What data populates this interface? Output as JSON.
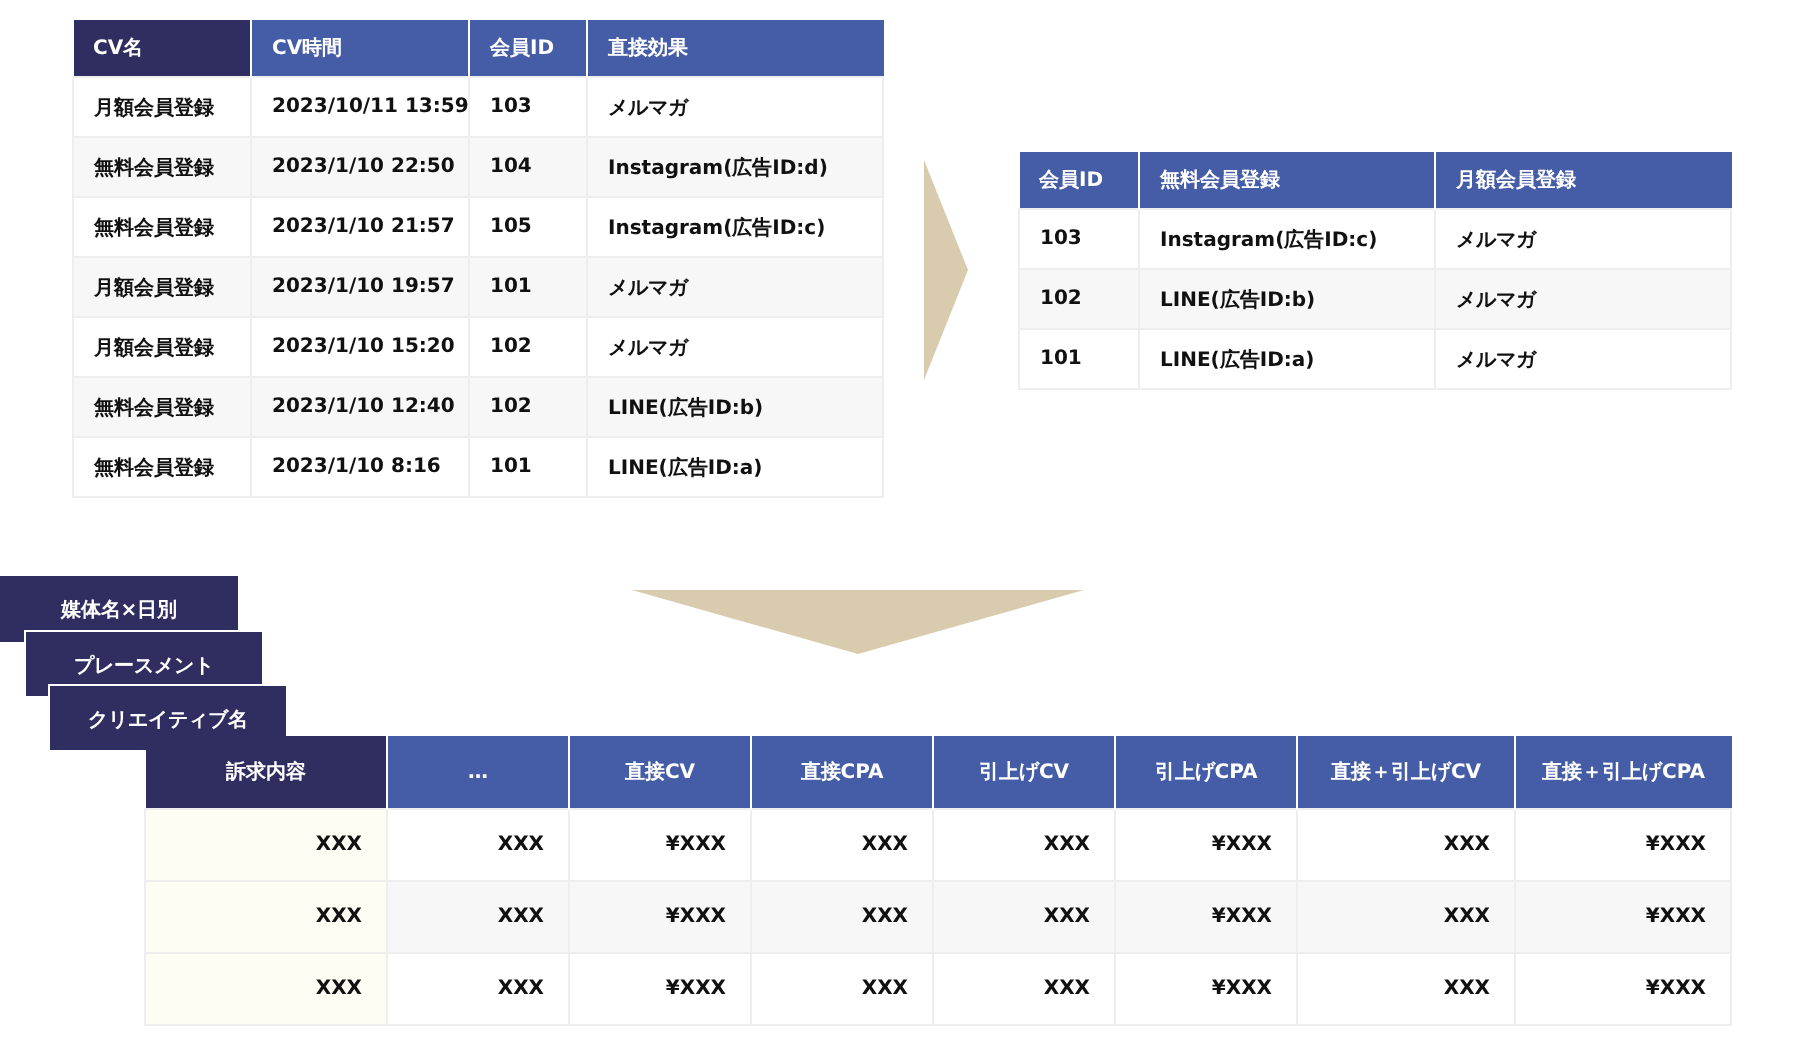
{
  "cv_table": {
    "columns": [
      {
        "label": "CV名",
        "emphasized": true
      },
      {
        "label": "CV時間",
        "emphasized": false
      },
      {
        "label": "会員ID",
        "emphasized": false
      },
      {
        "label": "直接効果",
        "emphasized": false
      }
    ],
    "rows": [
      [
        "月額会員登録",
        "2023/10/11 13:59",
        "103",
        "メルマガ"
      ],
      [
        "無料会員登録",
        "2023/1/10 22:50",
        "104",
        "Instagram(広告ID:d)"
      ],
      [
        "無料会員登録",
        "2023/1/10 21:57",
        "105",
        "Instagram(広告ID:c)"
      ],
      [
        "月額会員登録",
        "2023/1/10 19:57",
        "101",
        "メルマガ"
      ],
      [
        "月額会員登録",
        "2023/1/10 15:20",
        "102",
        "メルマガ"
      ],
      [
        "無料会員登録",
        "2023/1/10 12:40",
        "102",
        "LINE(広告ID:b)"
      ],
      [
        "無料会員登録",
        "2023/1/10 8:16",
        "101",
        "LINE(広告ID:a)"
      ]
    ]
  },
  "member_table": {
    "columns": [
      {
        "label": "会員ID",
        "emphasized": false
      },
      {
        "label": "無料会員登録",
        "emphasized": false
      },
      {
        "label": "月額会員登録",
        "emphasized": false
      }
    ],
    "rows": [
      [
        "103",
        "Instagram(広告ID:c)",
        "メルマガ"
      ],
      [
        "102",
        "LINE(広告ID:b)",
        "メルマガ"
      ],
      [
        "101",
        "LINE(広告ID:a)",
        "メルマガ"
      ]
    ]
  },
  "sheet_tabs": [
    "媒体名×日別",
    "プレースメント",
    "クリエイティブ名"
  ],
  "report_table": {
    "columns": [
      {
        "label": "訴求内容",
        "emphasized": true
      },
      {
        "label": "…",
        "emphasized": false
      },
      {
        "label": "直接CV",
        "emphasized": false
      },
      {
        "label": "直接CPA",
        "emphasized": false
      },
      {
        "label": "引上げCV",
        "emphasized": false
      },
      {
        "label": "引上げCPA",
        "emphasized": false
      },
      {
        "label": "直接＋引上げCV",
        "emphasized": false
      },
      {
        "label": "直接＋引上げCPA",
        "emphasized": false
      }
    ],
    "rows": [
      [
        "XXX",
        "XXX",
        "¥XXX",
        "XXX",
        "XXX",
        "¥XXX",
        "XXX",
        "¥XXX"
      ],
      [
        "XXX",
        "XXX",
        "¥XXX",
        "XXX",
        "XXX",
        "¥XXX",
        "XXX",
        "¥XXX"
      ],
      [
        "XXX",
        "XXX",
        "¥XXX",
        "XXX",
        "XXX",
        "¥XXX",
        "XXX",
        "¥XXX"
      ]
    ]
  }
}
